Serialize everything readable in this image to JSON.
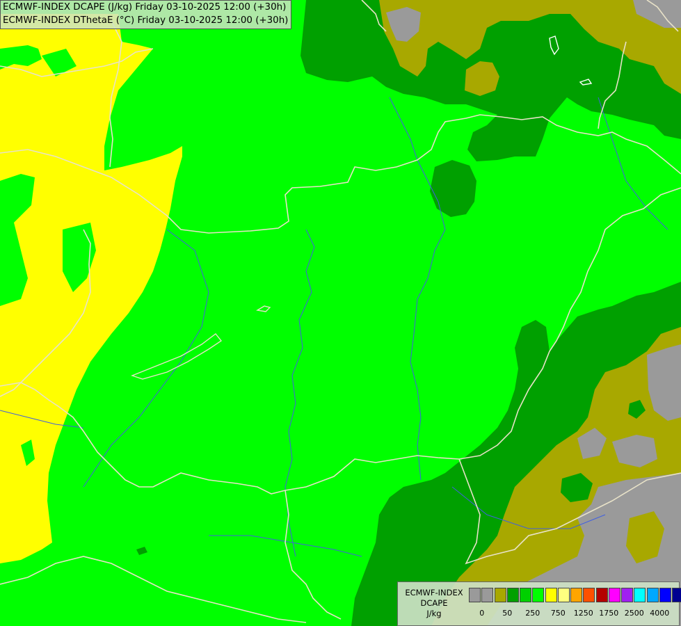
{
  "title": {
    "line1": "ECMWF-INDEX DCAPE (J/kg) Friday 03-10-2025 12:00 (+30h)",
    "line2": "ECMWF-INDEX DThetaE (°C) Friday 03-10-2025 12:00 (+30h)"
  },
  "legend": {
    "line1": "ECMWF-INDEX",
    "line2": "DCAPE",
    "line3": "J/kg",
    "colors": [
      "#9a9a9a",
      "#9a9a9a",
      "#a8a800",
      "#00a000",
      "#00d000",
      "#00ff00",
      "#ffff00",
      "#ffff80",
      "#ffa500",
      "#ff5000",
      "#b40000",
      "#ff00ff",
      "#a020f0",
      "#00ffff",
      "#00a8ff",
      "#0000ff",
      "#000090"
    ],
    "ticks": [
      {
        "label": "0",
        "index": 1
      },
      {
        "label": "50",
        "index": 3
      },
      {
        "label": "250",
        "index": 5
      },
      {
        "label": "750",
        "index": 7
      },
      {
        "label": "1250",
        "index": 9
      },
      {
        "label": "1750",
        "index": 11
      },
      {
        "label": "2500",
        "index": 13
      },
      {
        "label": "4000",
        "index": 15
      }
    ]
  },
  "map_colors": {
    "bright_green": "#00ff00",
    "dark_green": "#00a000",
    "olive": "#a8a800",
    "yellow": "#ffff00",
    "gray": "#9a9a9a",
    "border": "#e8e2c8",
    "river": "#4060e0"
  }
}
